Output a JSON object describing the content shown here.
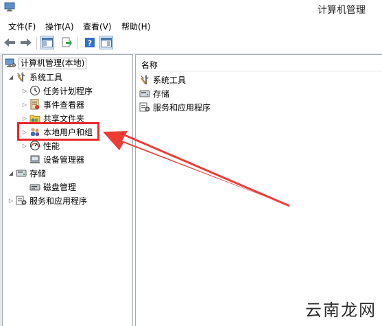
{
  "window": {
    "title": "计算机管理"
  },
  "menu": [
    {
      "label": "文件(F)"
    },
    {
      "label": "操作(A)"
    },
    {
      "label": "查看(V)"
    },
    {
      "label": "帮助(H)"
    }
  ],
  "toolbar": {
    "icons": [
      "back-arrow-icon",
      "forward-arrow-icon",
      "show-console-tree-icon",
      "export-list-icon",
      "help-icon",
      "show-action-pane-icon"
    ]
  },
  "tree": {
    "root": {
      "label": "计算机管理(本地)",
      "icon": "computer-management-icon"
    },
    "items": [
      {
        "label": "系统工具",
        "icon": "tools-icon",
        "expander": "expanded"
      },
      {
        "label": "任务计划程序",
        "icon": "clock-icon",
        "expander": "collapsed"
      },
      {
        "label": "事件查看器",
        "icon": "event-viewer-icon",
        "expander": "collapsed"
      },
      {
        "label": "共享文件夹",
        "icon": "shared-folder-icon",
        "expander": "collapsed"
      },
      {
        "label": "本地用户和组",
        "icon": "users-icon",
        "expander": "collapsed"
      },
      {
        "label": "性能",
        "icon": "performance-icon",
        "expander": "collapsed"
      },
      {
        "label": "设备管理器",
        "icon": "device-manager-icon",
        "expander": "none"
      },
      {
        "label": "存储",
        "icon": "storage-icon",
        "expander": "expanded"
      },
      {
        "label": "磁盘管理",
        "icon": "disk-icon",
        "expander": "none"
      },
      {
        "label": "服务和应用程序",
        "icon": "services-icon",
        "expander": "collapsed"
      }
    ]
  },
  "list": {
    "header": "名称",
    "items": [
      {
        "label": "系统工具",
        "icon": "tools-icon"
      },
      {
        "label": "存储",
        "icon": "storage-icon"
      },
      {
        "label": "服务和应用程序",
        "icon": "services-icon"
      }
    ]
  },
  "annotation": {
    "color": "#e8262a"
  },
  "watermark": {
    "text": "云南龙网"
  }
}
